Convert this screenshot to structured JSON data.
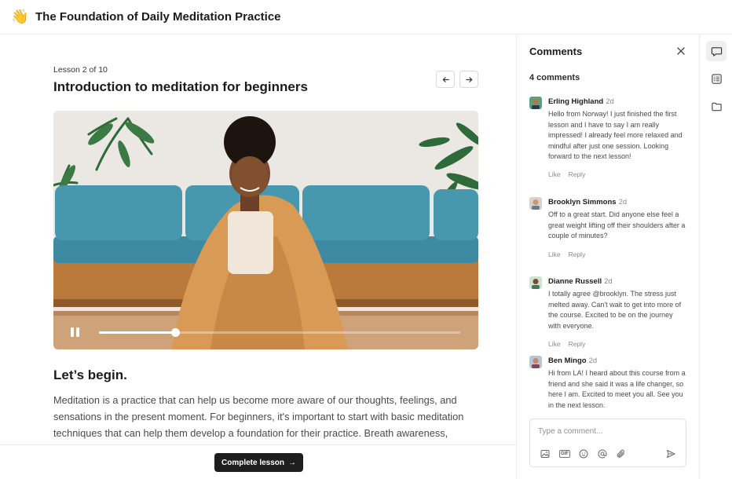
{
  "header": {
    "emoji": "👋",
    "title": "The Foundation of Daily Meditation Practice"
  },
  "lesson": {
    "counter": "Lesson 2 of 10",
    "title": "Introduction to meditation for beginners",
    "video_progress": 0.21,
    "section_heading": "Let’s begin.",
    "body": "Meditation is a practice that can help us become more aware of our thoughts, feelings, and sensations in the present moment. For beginners, it's important to start with basic meditation techniques that can help them develop a foundation for their practice. Breath awareness, body scan, and loving kindness meditations are some great starting points. It's also essential to",
    "complete_button": "Complete lesson",
    "complete_arrow": "→"
  },
  "comments": {
    "title": "Comments",
    "count_label": "4 comments",
    "like_label": "Like",
    "reply_label": "Reply",
    "items": [
      {
        "name": "Erling Highland",
        "time": "2d",
        "text": "Hello from Norway! I just finished the first lesson and I have to say I am really impressed! I already feel more relaxed and mindful after just one session. Looking forward to the next lesson!"
      },
      {
        "name": "Brooklyn Simmons",
        "time": "2d",
        "text": "Off to a great start. Did anyone else feel a great weight lifting off their shoulders after a couple of minutes?"
      },
      {
        "name": "Dianne Russell",
        "time": "2d",
        "text": "I totally agree @brooklyn. The stress just melted away. Can't wait to get into more of the course. Excited to be on the journey with everyone."
      },
      {
        "name": "Ben Mingo",
        "time": "2d",
        "text": "Hi from LA! I heard about this course from a friend and she said it was a life changer, so here I am. Excited to meet you all. See you in the next lesson."
      }
    ],
    "input_placeholder": "Type a comment...",
    "gif_label": "GIF"
  },
  "icons": {
    "rail": [
      "comment-icon",
      "checklist-icon",
      "folder-icon"
    ],
    "toolbar": [
      "image-icon",
      "gif-icon",
      "emoji-icon",
      "mention-icon",
      "attachment-icon",
      "send-icon"
    ]
  },
  "colors": {
    "primary_button": "#1e1e1e",
    "sofa": "#3f8fa8",
    "blanket": "#d89a55"
  }
}
